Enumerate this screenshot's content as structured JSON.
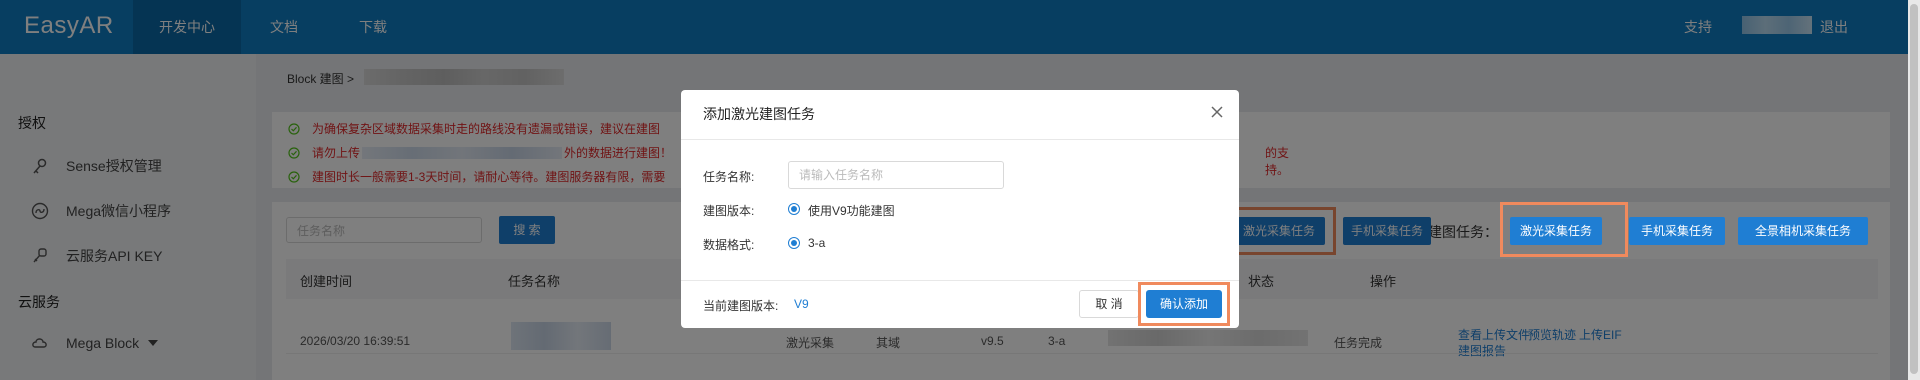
{
  "topbar": {
    "logo": "EasyAR",
    "nav": [
      "开发中心",
      "文档",
      "下载"
    ],
    "support": "支持",
    "logout": "退出"
  },
  "sidebar": {
    "section_auth": "授权",
    "auth_items": [
      {
        "label": "Sense授权管理",
        "icon": "key-icon"
      },
      {
        "label": "Mega微信小程序",
        "icon": "miniprogram-icon"
      },
      {
        "label": "云服务API KEY",
        "icon": "key-chain-icon"
      }
    ],
    "section_cloud": "云服务",
    "cloud_items": [
      {
        "label": "Mega Block",
        "icon": "cloud-icon"
      }
    ]
  },
  "main": {
    "breadcrumb": "Block 建图 >",
    "notices": [
      "为确保复杂区域数据采集时走的路线没有遗漏或错误，建议在建图",
      "请勿上传",
      "外的数据进行建图！",
      "的支持。",
      "建图时长一般需要1-3天时间，请耐心等待。建图服务器有限，需要"
    ],
    "search_placeholder": "任务名称",
    "search_button": "搜 索",
    "add_task_label": "添加建图任务：",
    "add_buttons": [
      "激光采集任务",
      "手机采集任务",
      "全景相机采集任务"
    ],
    "table": {
      "headers": [
        "创建时间",
        "任务名称",
        "状态",
        "操作"
      ],
      "row": {
        "created": "2026/03/20 16:39:51",
        "type": "激光采集",
        "region": "其域",
        "version": "v9.5",
        "format": "3-a",
        "status": "任务完成",
        "actions": [
          "查看上传文件",
          "预览轨迹",
          "上传EIF",
          "建图报告"
        ]
      }
    }
  },
  "modal": {
    "title": "添加激光建图任务",
    "name_label": "任务名称:",
    "name_placeholder": "请输入任务名称",
    "version_label": "建图版本:",
    "version_option": "使用V9功能建图",
    "format_label": "数据格式:",
    "format_option": "3-a",
    "current_version_label": "当前建图版本:",
    "current_version_value": "V9",
    "cancel": "取 消",
    "confirm": "确认添加"
  },
  "colors": {
    "topbar": "#0f7cc3",
    "primary": "#1f7ed3",
    "notice_red": "#e0282a",
    "highlight": "#f08a5d"
  }
}
